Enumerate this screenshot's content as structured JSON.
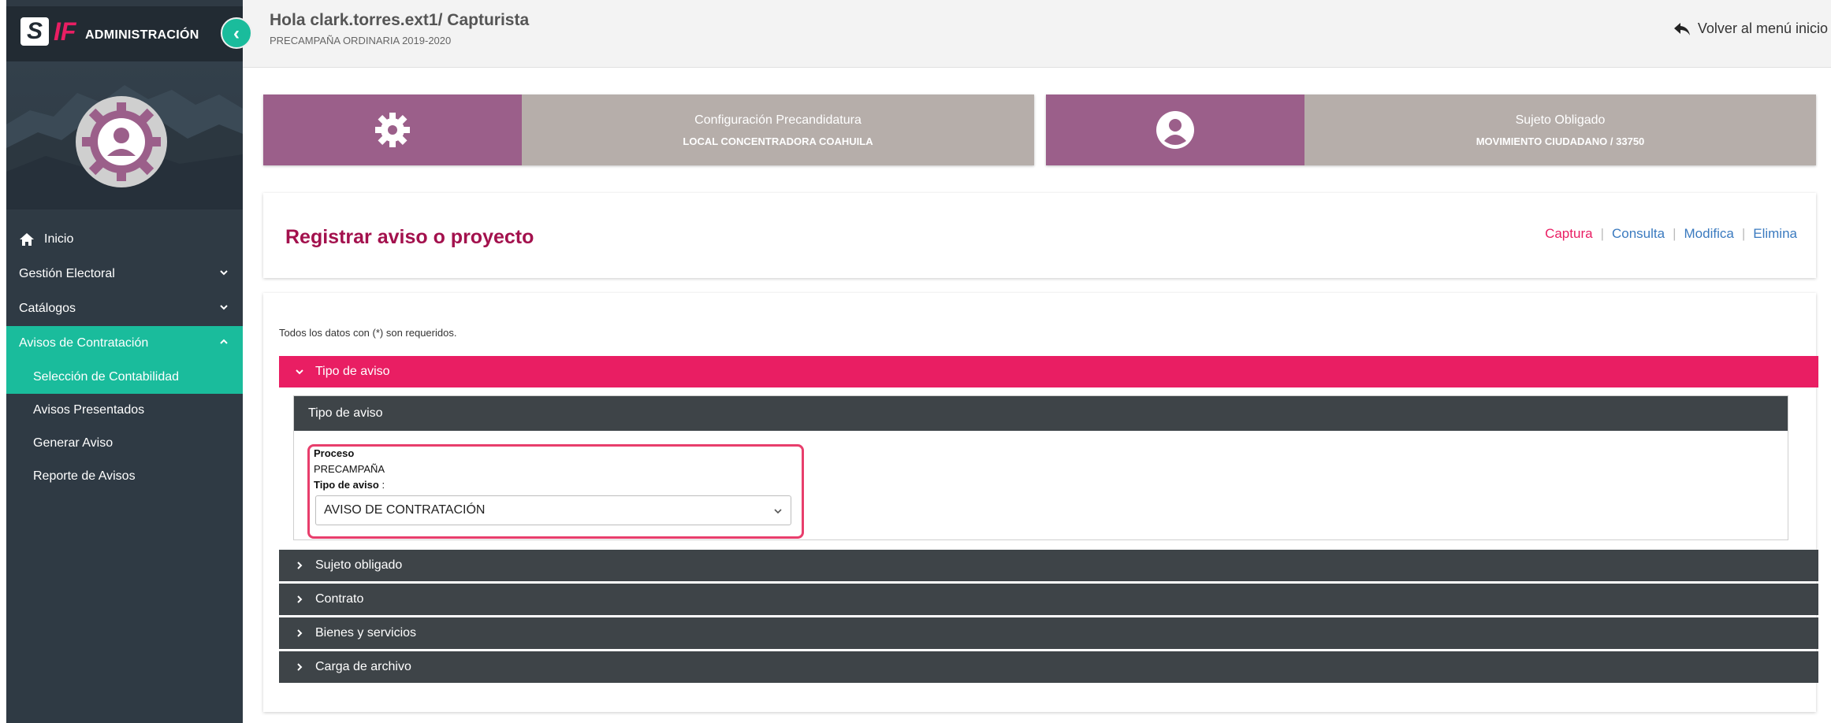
{
  "sidebar": {
    "app_title": "ADMINISTRACIÓN",
    "logo_text": "SIF",
    "nav": {
      "home": "Inicio",
      "gestion": "Gestión Electoral",
      "catalogos": "Catálogos",
      "avisos": "Avisos de Contratación"
    },
    "sub_items": [
      "Selección de Contabilidad",
      "Avisos Presentados",
      "Generar Aviso",
      "Reporte de Avisos"
    ]
  },
  "header": {
    "greeting": "Hola clark.torres.ext1/ Capturista",
    "period": "PRECAMPAÑA ORDINARIA 2019-2020",
    "back_link": "Volver al menú inicio"
  },
  "cards": {
    "config": {
      "title": "Configuración Precandidatura",
      "value": "LOCAL CONCENTRADORA COAHUILA"
    },
    "sujeto": {
      "title": "Sujeto Obligado",
      "value": "MOVIMIENTO CIUDADANO / 33750"
    }
  },
  "register": {
    "title": "Registrar aviso o proyecto",
    "links": {
      "captura": "Captura",
      "consulta": "Consulta",
      "modifica": "Modifica",
      "elimina": "Elimina"
    }
  },
  "form": {
    "required_note": "Todos los datos con (*) son requeridos.",
    "section_tipo": "Tipo de aviso",
    "inner_header": "Tipo de aviso",
    "proceso_label": "Proceso",
    "proceso_value": "PRECAMPAÑA",
    "tipo_label": "Tipo de aviso",
    "tipo_label_suffix": " :",
    "tipo_selected": "AVISO DE CONTRATACIÓN",
    "sections": [
      "Sujeto obligado",
      "Contrato",
      "Bienes y servicios",
      "Carga de archivo"
    ]
  },
  "colors": {
    "sidebar_bg": "#2f3a44",
    "accent_green": "#1abc9c",
    "pink": "#e91e63",
    "title_magenta": "#a3114d",
    "card_purple": "#9b5f8a",
    "card_gray": "#b6aeaa",
    "accordion_dark": "#3e4448",
    "link_blue": "#3a7abf"
  }
}
